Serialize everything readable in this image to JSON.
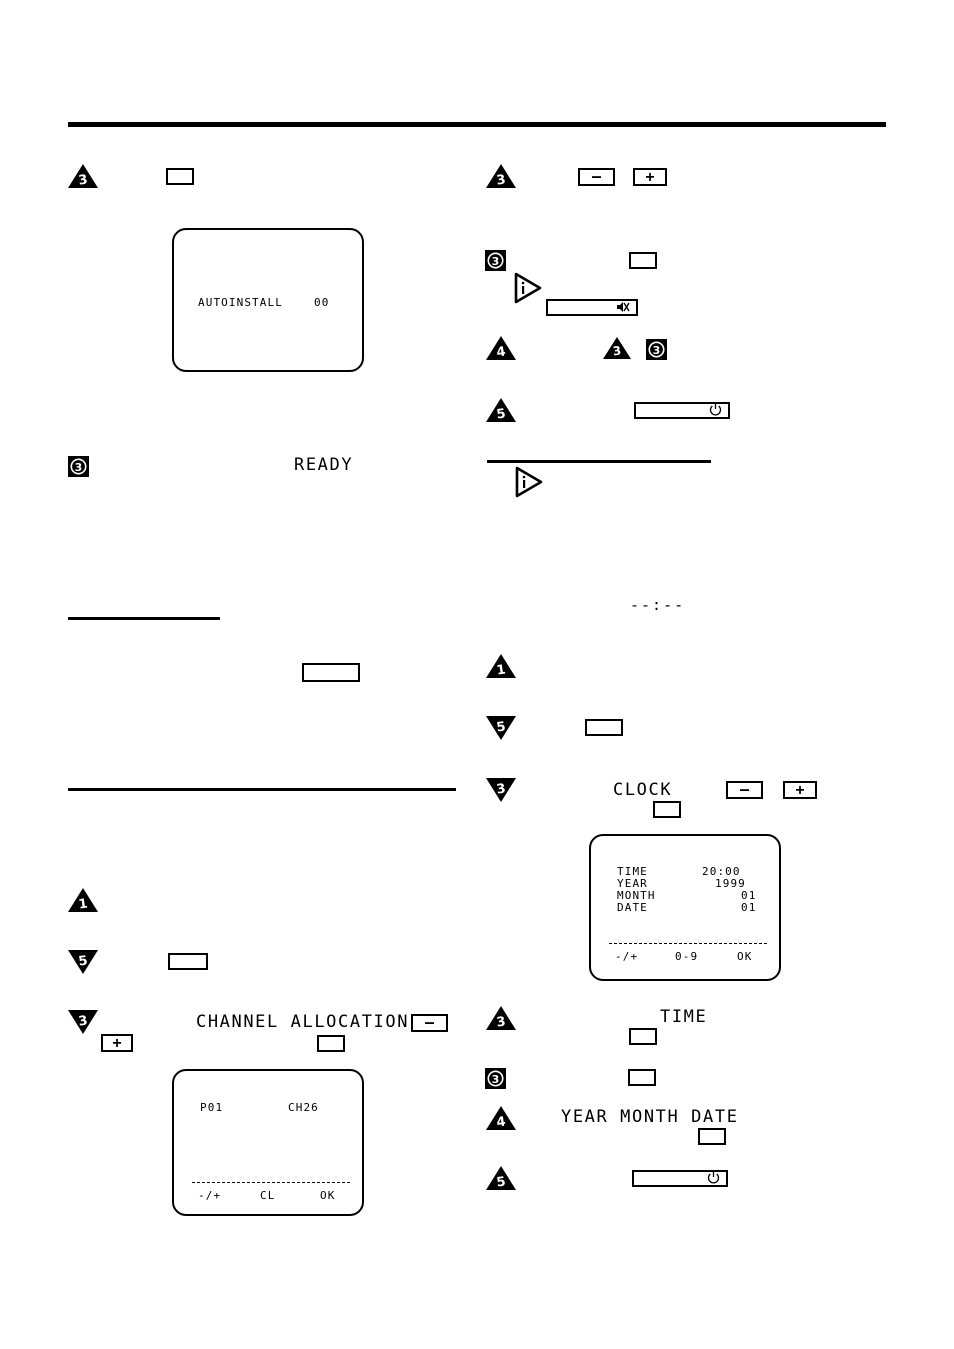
{
  "document": {
    "type": "instruction-manual-page",
    "columns": 2
  },
  "left_column": {
    "step_a": {
      "marker": "3",
      "marker_shape": "triangle-up",
      "key_label": ""
    },
    "tv_autoinstall": {
      "line_label": "AUTOINSTALL",
      "line_value": "00"
    },
    "step_ready": {
      "marker": "3",
      "marker_shape": "square-circle",
      "text": "READY"
    },
    "section_two": {
      "rule": true,
      "key_label": ""
    },
    "section_three": {
      "rule": true,
      "steps": [
        {
          "marker": "1",
          "marker_shape": "triangle-up",
          "text": ""
        },
        {
          "marker": "5",
          "marker_shape": "triangle-down",
          "key_label": ""
        },
        {
          "marker": "3",
          "marker_shape": "triangle-down",
          "text": "CHANNEL ALLOCATION",
          "key_minus": "–",
          "key_plus": "+",
          "key_blank": ""
        }
      ]
    },
    "tv_channel": {
      "program": "P01",
      "channel": "CH26",
      "footer": [
        "-/+",
        "CL",
        "OK"
      ]
    }
  },
  "right_column": {
    "step_minus_plus": {
      "marker": "3",
      "marker_shape": "triangle-up",
      "key_minus": "–",
      "key_plus": "+"
    },
    "step_mute": {
      "marker": "3",
      "marker_shape": "square-circle",
      "key_label": "",
      "info_icon": "i-play-icon",
      "mute_icon": "mute-speaker-icon"
    },
    "step_four": {
      "marker": "4",
      "marker_shape": "triangle-up",
      "ref_marker_a": "3",
      "ref_marker_a_shape": "triangle-up",
      "ref_marker_b": "3",
      "ref_marker_b_shape": "square-circle"
    },
    "step_five_power": {
      "marker": "5",
      "marker_shape": "triangle-up",
      "power_icon": "power-icon"
    },
    "section_clock": {
      "rule": true,
      "info_icon": "i-play-icon",
      "time_placeholder": "--:--",
      "steps": [
        {
          "marker": "1",
          "marker_shape": "triangle-up"
        },
        {
          "marker": "5",
          "marker_shape": "triangle-down",
          "key_label": ""
        },
        {
          "marker": "3",
          "marker_shape": "triangle-down",
          "text": "CLOCK",
          "key_minus": "–",
          "key_plus": "+",
          "key_blank": ""
        }
      ]
    },
    "tv_clock": {
      "rows": [
        {
          "label": "TIME",
          "value": "20:00"
        },
        {
          "label": "YEAR",
          "value": "1999"
        },
        {
          "label": "MONTH",
          "value": "01"
        },
        {
          "label": "DATE",
          "value": "01"
        }
      ],
      "footer": [
        "-/+",
        "0-9",
        "OK"
      ]
    },
    "steps_bottom": [
      {
        "marker": "3",
        "marker_shape": "triangle-up",
        "text": "TIME",
        "key_label": ""
      },
      {
        "marker": "3",
        "marker_shape": "square-circle",
        "key_label": ""
      },
      {
        "marker": "4",
        "marker_shape": "triangle-up",
        "text": "YEAR MONTH  DATE",
        "key_label": ""
      },
      {
        "marker": "5",
        "marker_shape": "triangle-up",
        "power_icon": "power-icon"
      }
    ]
  },
  "colors": {
    "ink": "#000000",
    "paper": "#ffffff"
  }
}
